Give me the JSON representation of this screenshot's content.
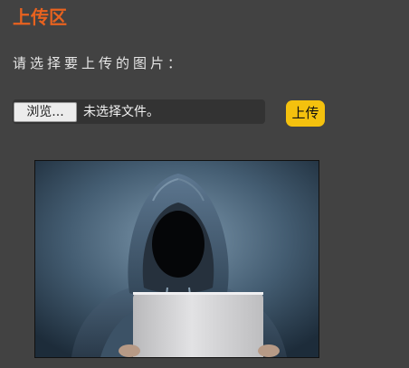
{
  "header": {
    "title": "上传区"
  },
  "form": {
    "prompt": "请选择要上传的图片：",
    "browse_label": "浏览...",
    "file_status": "未选择文件。",
    "upload_label": "上传"
  },
  "preview": {
    "subject": "hooded-figure-with-laptop",
    "colors": {
      "background_center": "#7d98ad",
      "background_edge": "#1d2c3a",
      "hoodie": "#4a6278",
      "laptop": "#d4d4d6"
    }
  },
  "colors": {
    "page_background": "#424242",
    "title": "#e8621f",
    "upload_button": "#f4c10e"
  }
}
